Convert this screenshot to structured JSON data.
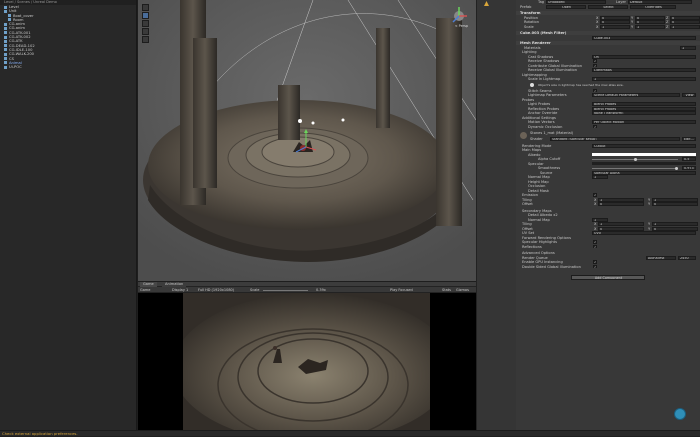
{
  "hierarchy": {
    "header": "Level / Scenes / Unreal Demo",
    "items": [
      {
        "label": "Level",
        "indent": 1
      },
      {
        "label": "Unit",
        "indent": 1
      },
      {
        "label": "Boat_cover",
        "indent": 2
      },
      {
        "label": "Room",
        "indent": 2
      },
      {
        "label": "CG-anim",
        "indent": 1
      },
      {
        "label": "CG-anim",
        "indent": 1
      },
      {
        "label": "CG-ATK-001",
        "indent": 1
      },
      {
        "label": "CG-ATK-002",
        "indent": 1
      },
      {
        "label": "CG-ATK",
        "indent": 1
      },
      {
        "label": "CG-DEAD-102",
        "indent": 1
      },
      {
        "label": "CG-IDLE-100",
        "indent": 1
      },
      {
        "label": "CG-WALK-200",
        "indent": 1
      },
      {
        "label": "CS",
        "indent": 1
      },
      {
        "label": "Animal",
        "indent": 1
      },
      {
        "label": "Ui-POC",
        "indent": 1
      }
    ]
  },
  "scene": {
    "gizmo_label": "< Persp"
  },
  "game": {
    "tabs": [
      "Game",
      "Animation"
    ],
    "display": "Display 1",
    "resolution": "Full HD (1920x1080)",
    "scale_label": "Scale",
    "scale_value": "0.39x",
    "play_focused": "Play Focused",
    "stats": "Stats",
    "gizmos": "Gizmos"
  },
  "inspector": {
    "tag_label": "Tag",
    "tag_value": "Untagged",
    "layer_label": "Layer",
    "layer_value": "Default",
    "prefab_label": "Prefab",
    "open": "Open",
    "select": "Select",
    "overrides": "Overrides",
    "transform": "Transform",
    "position": "Position",
    "rotation": "Rotation",
    "scale": "Scale",
    "x": "X",
    "y": "Y",
    "z": "Z",
    "pos": [
      "0",
      "0",
      "0"
    ],
    "rot": [
      "0",
      "0",
      "0"
    ],
    "scl": [
      "1",
      "1",
      "1"
    ],
    "mesh_filter": "Cube.003 (Mesh Filter)",
    "mesh_label": "Mesh",
    "mesh_value": "Cube.003",
    "mesh_renderer": "Mesh Renderer",
    "materials": "Materials",
    "materials_count": "1",
    "lighting": "Lighting",
    "cast_shadows": "Cast Shadows",
    "cast_shadows_value": "On",
    "receive_shadows": "Receive Shadows",
    "contribute_gi": "Contribute Global Illumination",
    "receive_gi": "Receive Global Illumination",
    "receive_gi_value": "Lightmaps",
    "lightmapping": "Lightmapping",
    "scale_in_lightmap": "Scale In Lightmap",
    "scale_in_lightmap_value": "1",
    "lightmap_info": "Object's size in lightmap has reached the max atlas size.",
    "stitch_seams": "Stitch Seams",
    "lightmap_params": "Lightmap Parameters",
    "lightmap_params_value": "Scene Default Parameters",
    "view": "View",
    "probes": "Probes",
    "light_probes": "Light Probes",
    "light_probes_value": "Blend Probes",
    "reflection_probes": "Reflection Probes",
    "reflection_probes_value": "Blend Probes",
    "anchor_override": "Anchor Override",
    "anchor_override_value": "None (Transform)",
    "additional_settings": "Additional Settings",
    "motion_vectors": "Motion Vectors",
    "motion_vectors_value": "Per Object Motion",
    "dynamic_occlusion": "Dynamic Occlusion",
    "material_name": "Stones 1_mat (Material)",
    "shader_label": "Shader",
    "shader_value": "Standard (Specular setup)",
    "edit": "Edit...",
    "rendering_mode": "Rendering Mode",
    "rendering_mode_value": "Cutout",
    "main_maps": "Main Maps",
    "albedo": "Albedo",
    "alpha_cutoff": "Alpha Cutoff",
    "alpha_cutoff_value": "0.5",
    "specular": "Specular",
    "smoothness": "Smoothness",
    "smoothness_value": "0.973",
    "source": "Source",
    "source_value": "Specular Alpha",
    "normal_map": "Normal Map",
    "normal_map_value": "1",
    "height_map": "Height Map",
    "occlusion": "Occlusion",
    "detail_mask": "Detail Mask",
    "emission": "Emission",
    "tiling": "Tiling",
    "offset": "Offset",
    "tiling_xy": [
      "1",
      "1"
    ],
    "offset_xy": [
      "0",
      "0"
    ],
    "secondary_maps": "Secondary Maps",
    "detail_albedo": "Detail Albedo x2",
    "normal_map2": "Normal Map",
    "normal_map2_value": "1",
    "tiling2_xy": [
      "1",
      "1"
    ],
    "offset2_xy": [
      "0",
      "0"
    ],
    "uv_set": "UV Set",
    "uv_set_value": "UV0",
    "forward_options": "Forward Rendering Options",
    "specular_highlights": "Specular Highlights",
    "reflections": "Reflections",
    "advanced_options": "Advanced Options",
    "render_queue": "Render Queue",
    "render_queue_mode": "AlphaTest",
    "render_queue_value": "2450",
    "gpu_instancing": "Enable GPU Instancing",
    "double_sided_gi": "Double Sided Global Illumination",
    "add_component": "Add Component"
  },
  "status": {
    "message": "Check external application preferences."
  },
  "colors": {
    "accent": "#3c7bbf",
    "warning": "#d9a63a"
  }
}
